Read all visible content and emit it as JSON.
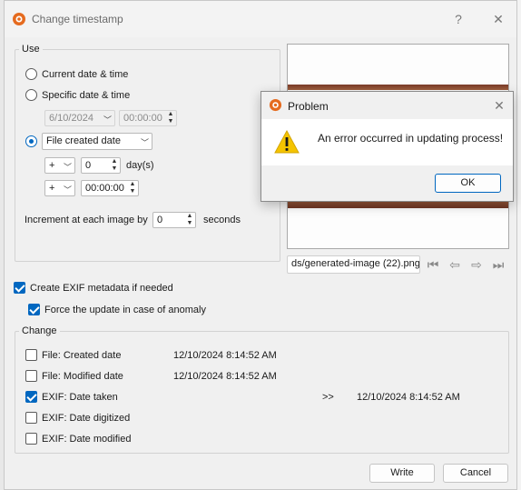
{
  "window": {
    "title": "Change timestamp",
    "help_label": "?",
    "close_label": "✕"
  },
  "use_group": {
    "title": "Use",
    "current_label": "Current date & time",
    "specific_label": "Specific date & time",
    "specific_date": "6/10/2024",
    "specific_time": "00:00:00",
    "file_source_value": "File created date",
    "offset1_sign": "+",
    "offset1_days": "0",
    "offset1_unit": "day(s)",
    "offset2_sign": "+",
    "offset2_time": "00:00:00",
    "increment_label": "Increment at each image by",
    "increment_value": "0",
    "increment_unit": "seconds"
  },
  "preview": {
    "filename": "ds/generated-image (22).png"
  },
  "options": {
    "create_exif_label": "Create EXIF metadata if needed",
    "force_update_label": "Force the update in case of anomaly"
  },
  "change_group": {
    "title": "Change",
    "rows": [
      {
        "label": "File: Created date",
        "value": "12/10/2024 8:14:52 AM",
        "checked": false,
        "arrow": "",
        "new_value": ""
      },
      {
        "label": "File: Modified date",
        "value": "12/10/2024 8:14:52 AM",
        "checked": false,
        "arrow": "",
        "new_value": ""
      },
      {
        "label": "EXIF: Date taken",
        "value": "",
        "checked": true,
        "arrow": ">>",
        "new_value": "12/10/2024 8:14:52 AM"
      },
      {
        "label": "EXIF: Date digitized",
        "value": "",
        "checked": false,
        "arrow": "",
        "new_value": ""
      },
      {
        "label": "EXIF: Date modified",
        "value": "",
        "checked": false,
        "arrow": "",
        "new_value": ""
      }
    ]
  },
  "buttons": {
    "write": "Write",
    "cancel": "Cancel"
  },
  "dialog": {
    "title": "Problem",
    "message": "An error occurred in updating process!",
    "ok": "OK",
    "close_label": "✕"
  },
  "colors": {
    "accent": "#0067c0",
    "warning": "#f5c400"
  },
  "icons": {
    "app": "xnview-logo-icon",
    "warning": "warning-triangle-icon",
    "nav_first": "first-icon",
    "nav_prev": "previous-icon",
    "nav_next": "next-icon",
    "nav_last": "last-icon"
  }
}
